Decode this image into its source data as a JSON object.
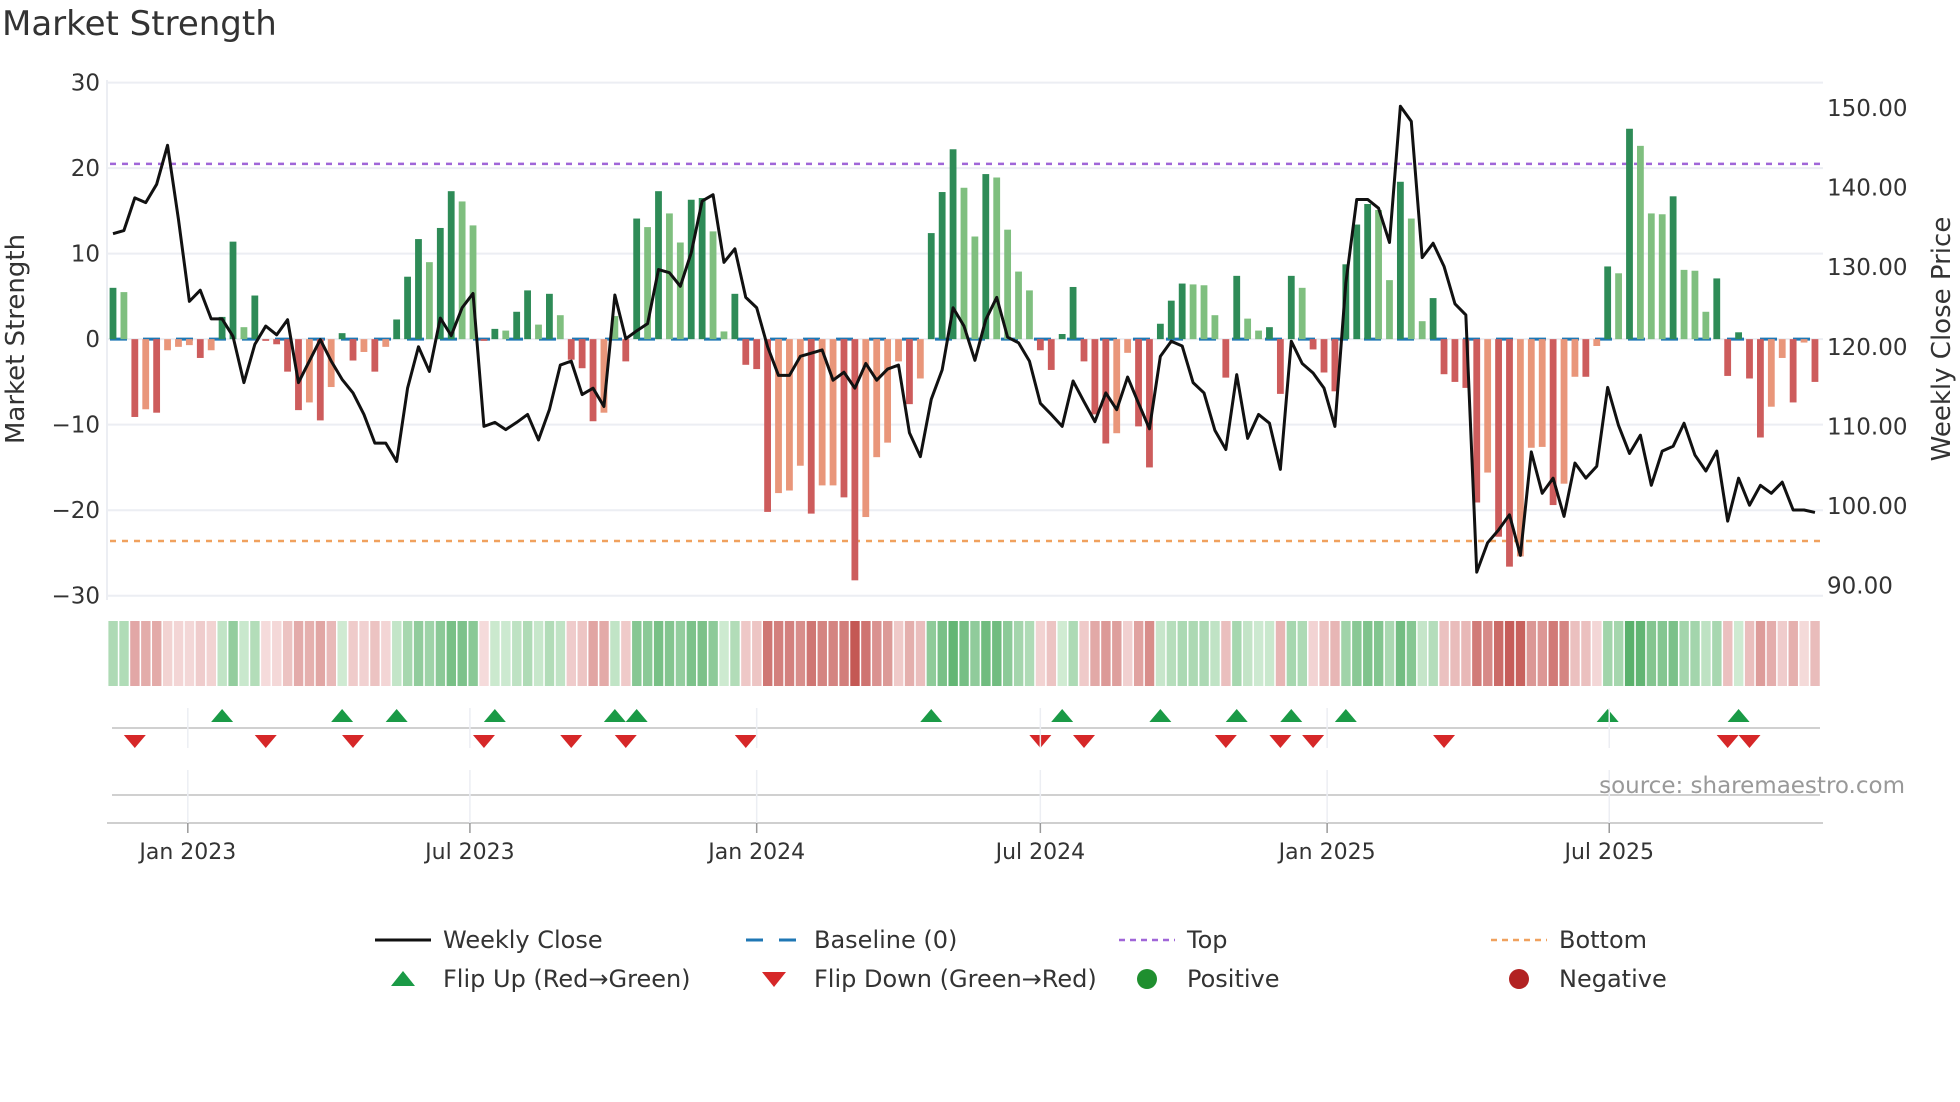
{
  "chart_data": {
    "type": "bar",
    "title": "Market Strength",
    "ylabel_left": "Market Strength",
    "ylabel_right": "Weekly Close Price",
    "ylim_left": [
      -30.5,
      30.3
    ],
    "ylim_right": [
      88.2,
      153.5
    ],
    "yticks_left": [
      {
        "v": 30,
        "label": "30"
      },
      {
        "v": 20,
        "label": "20"
      },
      {
        "v": 10,
        "label": "10"
      },
      {
        "v": 0,
        "label": "0"
      },
      {
        "v": -10,
        "label": "−10"
      },
      {
        "v": -20,
        "label": "−20"
      },
      {
        "v": -30,
        "label": "−30"
      }
    ],
    "yticks_right": [
      {
        "v": 150,
        "label": "150.00"
      },
      {
        "v": 140,
        "label": "140.00"
      },
      {
        "v": 130,
        "label": "130.00"
      },
      {
        "v": 120,
        "label": "120.00"
      },
      {
        "v": 110,
        "label": "110.00"
      },
      {
        "v": 100,
        "label": "100.00"
      },
      {
        "v": 90,
        "label": "90.00"
      }
    ],
    "xticks": [
      {
        "date": "2023-01-01",
        "label": "Jan 2023"
      },
      {
        "date": "2023-07-01",
        "label": "Jul 2023"
      },
      {
        "date": "2024-01-01",
        "label": "Jan 2024"
      },
      {
        "date": "2024-07-01",
        "label": "Jul 2024"
      },
      {
        "date": "2025-01-01",
        "label": "Jan 2025"
      },
      {
        "date": "2025-07-01",
        "label": "Jul 2025"
      }
    ],
    "start_week": "2022-11-14",
    "interval": "weekly",
    "top_level": 20.5,
    "bottom_level": -23.6,
    "baseline": 0,
    "strength": [
      6.0,
      5.5,
      -9.1,
      -8.2,
      -8.6,
      -1.3,
      -0.9,
      -0.7,
      -2.2,
      -1.3,
      2.6,
      11.4,
      1.4,
      5.1,
      -0.2,
      -0.6,
      -3.8,
      -8.3,
      -7.4,
      -9.5,
      -5.6,
      0.7,
      -2.5,
      -1.5,
      -3.8,
      -0.9,
      2.3,
      7.3,
      11.7,
      9.0,
      13.0,
      17.3,
      16.1,
      13.3,
      -0.2,
      1.2,
      1.0,
      3.2,
      5.7,
      1.7,
      5.3,
      2.8,
      -2.4,
      -3.4,
      -9.6,
      -8.6,
      2.7,
      -2.6,
      14.1,
      13.1,
      17.3,
      14.7,
      11.3,
      16.3,
      16.5,
      12.6,
      0.9,
      5.3,
      -3.0,
      -3.5,
      -20.2,
      -18.0,
      -17.7,
      -14.8,
      -20.4,
      -17.1,
      -17.1,
      -18.5,
      -28.2,
      -20.8,
      -13.8,
      -12.1,
      -2.6,
      -7.6,
      -4.6,
      12.4,
      17.2,
      22.2,
      17.7,
      12.0,
      19.3,
      18.9,
      12.8,
      7.9,
      5.7,
      -1.3,
      -3.6,
      0.6,
      6.1,
      -2.6,
      -8.8,
      -12.2,
      -11.0,
      -1.6,
      -10.2,
      -15.0,
      1.8,
      4.5,
      6.5,
      6.4,
      6.3,
      2.8,
      -4.5,
      7.4,
      2.4,
      1.0,
      1.4,
      -6.4,
      7.4,
      6.0,
      -1.2,
      -3.9,
      -6.1,
      8.75,
      13.4,
      15.8,
      15.1,
      6.9,
      18.4,
      14.1,
      2.1,
      4.8,
      -4.1,
      -5.0,
      -5.7,
      -19.1,
      -15.6,
      -23.1,
      -26.6,
      -25.4,
      -12.7,
      -12.6,
      -19.4,
      -16.9,
      -4.4,
      -4.4,
      -0.8,
      8.5,
      7.7,
      24.6,
      22.6,
      14.7,
      14.6,
      16.7,
      8.1,
      8.0,
      3.2,
      7.1,
      -4.3,
      0.8,
      -4.6,
      -11.5,
      -7.9,
      -2.2,
      -7.4,
      -0.4,
      -5.0
    ],
    "shade": "DLRSRSSSRSDDLDRRRRSRSDRSRSDDDLDDLLRDLDDLDLRRRSLRDLDLLDDLLDRRRSSSRSSRRSSSSRSDDDLLDLLLLRRDDRRRSSRRDDDLLLRDLLDRDLRRRDDDLLDLLDRRRRSRRSSSRSSRSDLDLLLDLLLDRDRRSSRSR",
    "shade_colors": {
      "D": "#2e8b57",
      "L": "#7fbf7f",
      "R": "#cd5c5c",
      "S": "#e9967a"
    },
    "close": [
      134.2,
      134.6,
      138.7,
      138.1,
      140.4,
      145.3,
      136.0,
      125.7,
      127.1,
      123.5,
      123.5,
      121.3,
      115.5,
      120.3,
      122.6,
      121.5,
      123.4,
      115.5,
      118.2,
      120.9,
      118.2,
      115.9,
      114.2,
      111.5,
      107.9,
      107.9,
      105.6,
      114.8,
      120.0,
      116.9,
      123.6,
      121.4,
      124.9,
      126.7,
      110.0,
      110.5,
      109.6,
      110.5,
      111.5,
      108.3,
      112.1,
      117.7,
      118.2,
      114.0,
      114.8,
      112.5,
      126.5,
      121.0,
      122.0,
      122.9,
      129.7,
      129.3,
      127.6,
      131.8,
      138.3,
      139.1,
      130.6,
      132.3,
      126.2,
      124.9,
      120.0,
      116.4,
      116.4,
      118.8,
      119.2,
      119.6,
      115.8,
      116.8,
      114.8,
      117.9,
      115.8,
      117.2,
      117.7,
      109.2,
      106.2,
      113.4,
      117.1,
      124.9,
      122.6,
      118.3,
      123.4,
      126.2,
      121.2,
      120.5,
      118.2,
      112.9,
      111.5,
      110.0,
      115.7,
      113.1,
      110.6,
      114.2,
      112.1,
      116.2,
      112.9,
      109.7,
      118.8,
      120.7,
      120.1,
      115.5,
      114.2,
      109.5,
      107.1,
      116.5,
      108.5,
      111.5,
      110.4,
      104.6,
      120.7,
      117.9,
      116.7,
      114.8,
      110.0,
      128.0,
      138.5,
      138.5,
      137.4,
      133.1,
      150.2,
      148.3,
      131.2,
      133.0,
      130.1,
      125.4,
      124.0,
      91.7,
      95.4,
      97.0,
      98.9,
      93.8,
      106.8,
      101.6,
      103.5,
      98.7,
      105.4,
      103.5,
      105.0,
      114.9,
      110.1,
      106.6,
      108.9,
      102.6,
      106.9,
      107.5,
      110.4,
      106.4,
      104.4,
      106.9,
      98.1,
      103.5,
      100.1,
      102.6,
      101.6,
      103.0,
      99.5,
      99.5,
      99.2
    ],
    "flips_up_week": [
      11,
      22,
      27,
      36,
      47,
      49,
      76,
      88,
      97,
      104,
      109,
      114,
      138,
      150
    ],
    "flips_down_week": [
      3,
      15,
      23,
      35,
      43,
      48,
      59,
      86,
      90,
      103,
      108,
      111,
      123,
      149,
      151
    ],
    "colors": {
      "close": "#111111",
      "baseline": "#1f77b4",
      "top": "#a066d8",
      "bottom": "#f0a15e",
      "flip_up": "#1a9a46",
      "flip_down": "#d62728",
      "positive": "#1f8f2f",
      "negative": "#b22222"
    },
    "legend": [
      {
        "key": "close",
        "label": "Weekly Close"
      },
      {
        "key": "baseline",
        "label": "Baseline (0)"
      },
      {
        "key": "top",
        "label": "Top"
      },
      {
        "key": "bottom",
        "label": "Bottom"
      },
      {
        "key": "flip_up",
        "label": "Flip Up (Red→Green)"
      },
      {
        "key": "flip_down",
        "label": "Flip Down (Green→Red)"
      },
      {
        "key": "positive",
        "label": "Positive"
      },
      {
        "key": "negative",
        "label": "Negative"
      }
    ],
    "legend_placement": "bottom",
    "grid": true,
    "source": "source: sharemaestro.com"
  }
}
